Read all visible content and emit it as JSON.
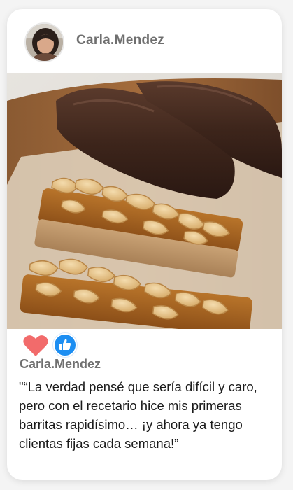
{
  "post": {
    "author": "Carla.Mendez",
    "reactions": [
      "heart-icon",
      "thumbs-up-icon"
    ],
    "reaction_colors": {
      "heart": "#f26b6b",
      "like": "#1c8ef2"
    },
    "footer_author": "Carla.Mendez",
    "quote": "\"“La verdad pensé que sería difícil y caro, pero con el recetario hice mis primeras barritas rapidísimo… ¡y ahora ya tengo clientas fijas cada semana!”"
  }
}
